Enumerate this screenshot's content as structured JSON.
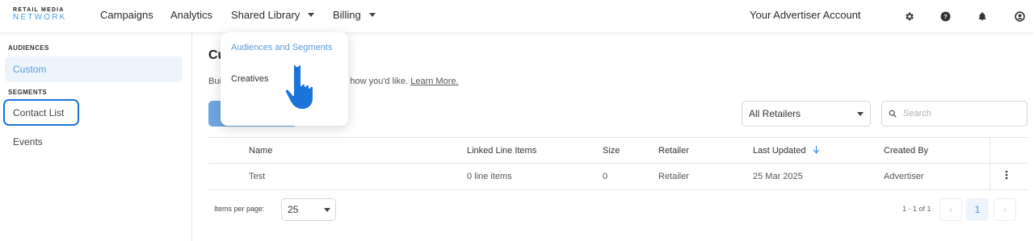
{
  "brand": {
    "line1": "RETAIL MEDIA",
    "line2": "NETWORK"
  },
  "nav": {
    "items": [
      {
        "label": "Campaigns"
      },
      {
        "label": "Analytics"
      },
      {
        "label": "Shared Library"
      },
      {
        "label": "Billing"
      }
    ],
    "account": "Your Advertiser Account"
  },
  "icons": {
    "settings": "gear-icon",
    "help": "help-icon",
    "notifications": "bell-icon",
    "user": "user-icon"
  },
  "sidebar": {
    "sections": [
      {
        "title": "AUDIENCES",
        "items": [
          {
            "label": "Custom"
          }
        ]
      },
      {
        "title": "SEGMENTS",
        "items": [
          {
            "label": "Contact List"
          },
          {
            "label": "Events"
          }
        ]
      }
    ]
  },
  "main": {
    "title": "Cu",
    "description_prefix": "Bui",
    "description_suffix": "n people just how you'd like.",
    "learn_more": "Learn More."
  },
  "filters": {
    "retailer_select": "All Retailers",
    "search_placeholder": "Search"
  },
  "table": {
    "headers": {
      "name": "Name",
      "linked": "Linked Line Items",
      "size": "Size",
      "retailer": "Retailer",
      "updated": "Last Updated",
      "created_by": "Created By"
    },
    "rows": [
      {
        "name": "Test",
        "linked": "0 line items",
        "size": "0",
        "retailer": "Retailer",
        "updated": "25 Mar 2025",
        "created_by": "Advertiser"
      }
    ]
  },
  "pagination": {
    "items_per_page_label": "Items per page:",
    "items_per_page": "25",
    "range": "1 - 1 of 1",
    "current_page": "1",
    "prev": "‹",
    "next": "›"
  },
  "dropdown": {
    "items": [
      {
        "label": "Audiences and Segments"
      },
      {
        "label": "Creatives"
      }
    ]
  },
  "colors": {
    "accent": "#5a9bd8",
    "highlight": "#1b74d9",
    "active_bg": "#eef4fb"
  }
}
